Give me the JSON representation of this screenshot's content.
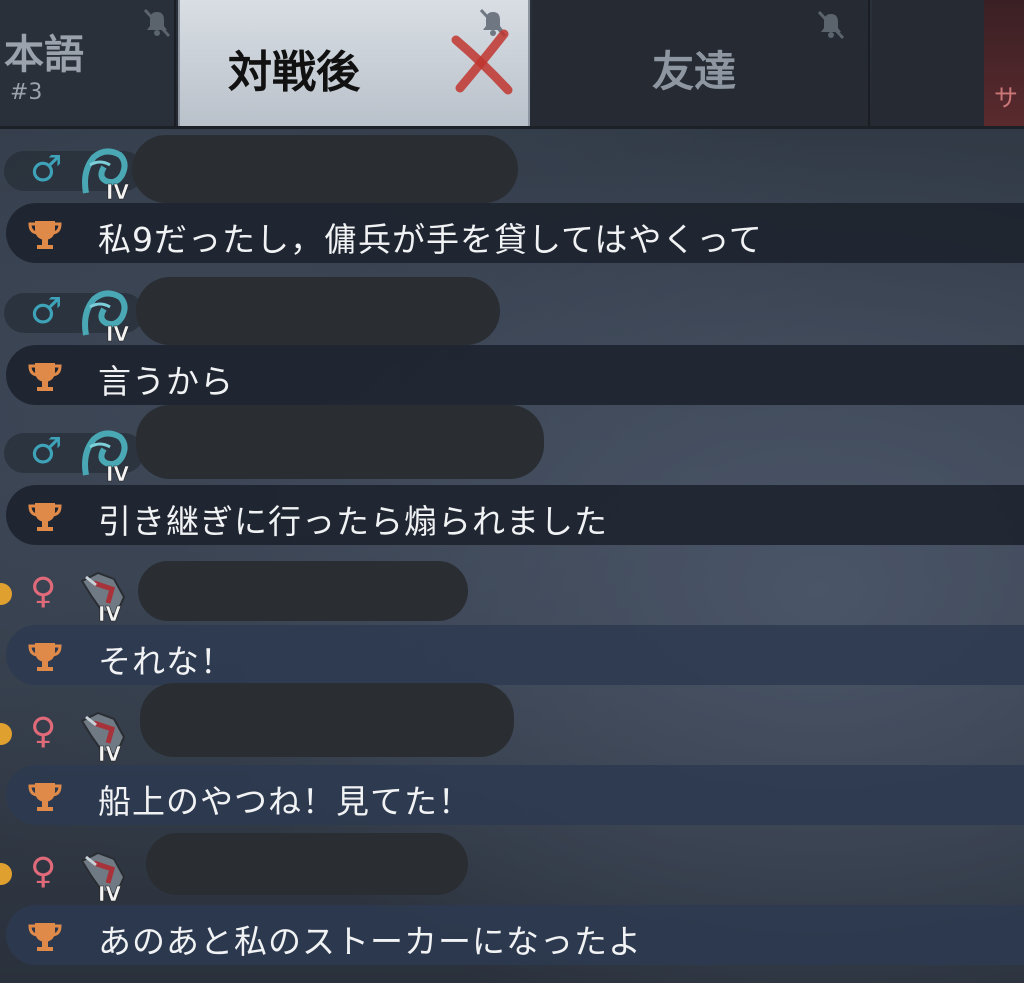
{
  "tabs": {
    "left": {
      "label": "本語",
      "sub": "#3"
    },
    "active": {
      "label": "対戦後"
    },
    "middle": {
      "label": "友達"
    },
    "right_edge": {
      "label": "サ"
    }
  },
  "messages": [
    {
      "gender": "♂",
      "gender_type": "male",
      "text": "私9だったし，傭兵が手を貸してはやくって"
    },
    {
      "gender": "♂",
      "gender_type": "male",
      "text": "言うから"
    },
    {
      "gender": "♂",
      "gender_type": "male",
      "text": "引き継ぎに行ったら煽られました"
    },
    {
      "gender": "♀",
      "gender_type": "female",
      "text": "それな！"
    },
    {
      "gender": "♀",
      "gender_type": "female",
      "text": "船上のやつね！見てた！"
    },
    {
      "gender": "♀",
      "gender_type": "female",
      "text": "あのあと私のストーカーになったよ"
    }
  ],
  "avatar_badge": {
    "male": "IV",
    "female": "IV"
  },
  "colors": {
    "male": "#3ea3b8",
    "female": "#e06a7a",
    "trophy": "#e08a4a"
  }
}
